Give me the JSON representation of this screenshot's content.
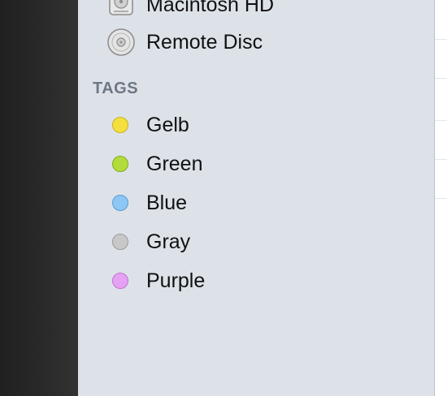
{
  "sidebar": {
    "devices": [
      {
        "label": "Macintosh HD",
        "icon": "hard-drive-icon"
      },
      {
        "label": "Remote Disc",
        "icon": "optical-disc-icon"
      }
    ],
    "tags_header": "TAGS",
    "tags": [
      {
        "label": "Gelb",
        "color": "#f4df3c",
        "border": "#c9b41f"
      },
      {
        "label": "Green",
        "color": "#b2dc3c",
        "border": "#86ac20"
      },
      {
        "label": "Blue",
        "color": "#8ec7f5",
        "border": "#5b9bd0"
      },
      {
        "label": "Gray",
        "color": "#c8c8c8",
        "border": "#9a9a9a"
      },
      {
        "label": "Purple",
        "color": "#e6a2f2",
        "border": "#c16fd6"
      }
    ]
  }
}
